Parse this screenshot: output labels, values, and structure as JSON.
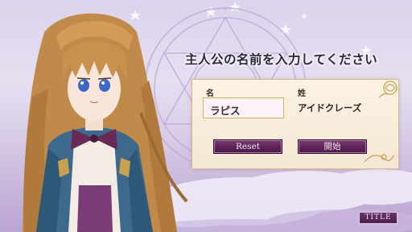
{
  "screen": {
    "heading": "主人公の名前を入力してください"
  },
  "name_form": {
    "given_label": "名",
    "given_value": "ラピス",
    "family_label": "姓",
    "family_value": "アイドクレーズ"
  },
  "buttons": {
    "reset_label": "Reset",
    "start_label": "開始",
    "title_label": "TITLE"
  },
  "colors": {
    "button_purple": "#5c2356",
    "panel_cream": "#fbf0e0",
    "panel_border": "#d9bb8a",
    "sky_lavender": "#dcd3ec"
  },
  "icons": {
    "panel_ornament": "rose-ornament-icon",
    "stars": "star-icon"
  }
}
